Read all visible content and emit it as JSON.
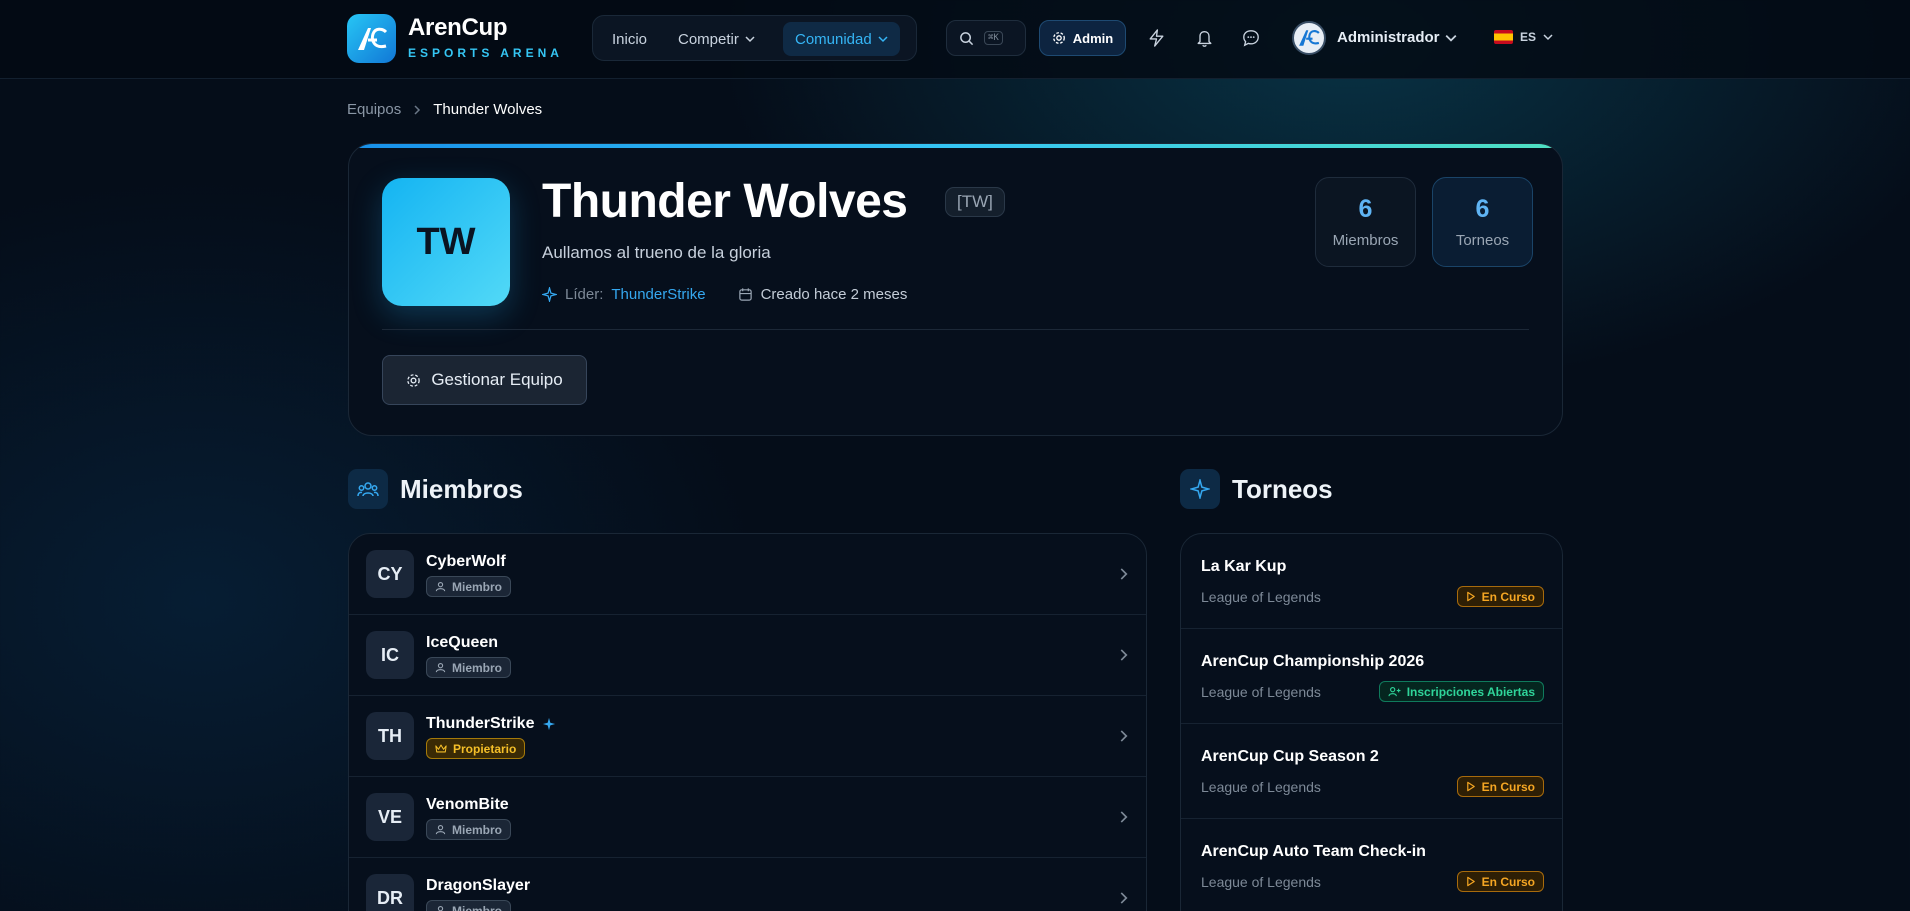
{
  "header": {
    "brand_name": "ArenCup",
    "brand_sub": "ESPORTS ARENA",
    "nav": [
      {
        "label": "Inicio"
      },
      {
        "label": "Competir"
      },
      {
        "label": "Comunidad"
      }
    ],
    "search_shortcut": "⌘K",
    "admin_label": "Admin",
    "user_name": "Administrador",
    "language": "ES"
  },
  "breadcrumb": {
    "parent": "Equipos",
    "current": "Thunder Wolves"
  },
  "team": {
    "initials": "TW",
    "name": "Thunder Wolves",
    "tag": "[TW]",
    "motto": "Aullamos al trueno de la gloria",
    "leader_label": "Líder:",
    "leader": "ThunderStrike",
    "created": "Creado hace 2 meses",
    "stats": {
      "members_value": "6",
      "members_label": "Miembros",
      "tournaments_value": "6",
      "tournaments_label": "Torneos"
    },
    "manage_label": "Gestionar Equipo"
  },
  "members_section": {
    "title": "Miembros",
    "items": [
      {
        "initials": "CY",
        "name": "CyberWolf",
        "role": "Miembro"
      },
      {
        "initials": "IC",
        "name": "IceQueen",
        "role": "Miembro"
      },
      {
        "initials": "TH",
        "name": "ThunderStrike",
        "role": "Propietario"
      },
      {
        "initials": "VE",
        "name": "VenomBite",
        "role": "Miembro"
      },
      {
        "initials": "DR",
        "name": "DragonSlayer",
        "role": "Miembro"
      }
    ]
  },
  "tournaments_section": {
    "title": "Torneos",
    "items": [
      {
        "name": "La Kar Kup",
        "game": "League of Legends",
        "status": "En Curso"
      },
      {
        "name": "ArenCup Championship 2026",
        "game": "League of Legends",
        "status": "Inscripciones Abiertas"
      },
      {
        "name": "ArenCup Cup Season 2",
        "game": "League of Legends",
        "status": "En Curso"
      },
      {
        "name": "ArenCup Auto Team Check-in",
        "game": "League of Legends",
        "status": "En Curso"
      }
    ]
  },
  "colors": {
    "accent": "#35b5f5",
    "background": "#050d19",
    "owner_badge": "#f5bf29",
    "live_status": "#f5a623",
    "open_status": "#2fd59a"
  }
}
